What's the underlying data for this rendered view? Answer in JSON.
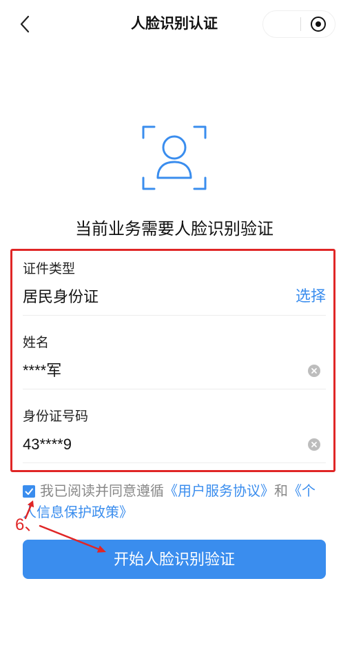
{
  "nav": {
    "title": "人脸识别认证",
    "back_icon": "chevron-left-icon",
    "capsule_icon": "target-circle-icon"
  },
  "main": {
    "face_icon": "face-scan-icon",
    "prompt": "当前业务需要人脸识别验证"
  },
  "form": {
    "fields": [
      {
        "label": "证件类型",
        "value": "居民身份证",
        "action": "选择"
      },
      {
        "label": "姓名",
        "value": "****军",
        "clear_icon": "clear-icon"
      },
      {
        "label": "身份证号码",
        "value": "43****9",
        "clear_icon": "clear-icon"
      }
    ]
  },
  "agreement": {
    "checked": true,
    "text": "我已阅读并同意遵循",
    "service_link": "《用户服务协议》",
    "conjunction": "和",
    "privacy_link": "《个人信息保护政策》"
  },
  "primary_button": {
    "label": "开始人脸识别验证"
  },
  "annotation": {
    "step_label": "6、"
  },
  "colors": {
    "primary": "#3a8dee",
    "annotation_red": "#e02626",
    "text": "#111111",
    "muted_text": "#888888"
  }
}
